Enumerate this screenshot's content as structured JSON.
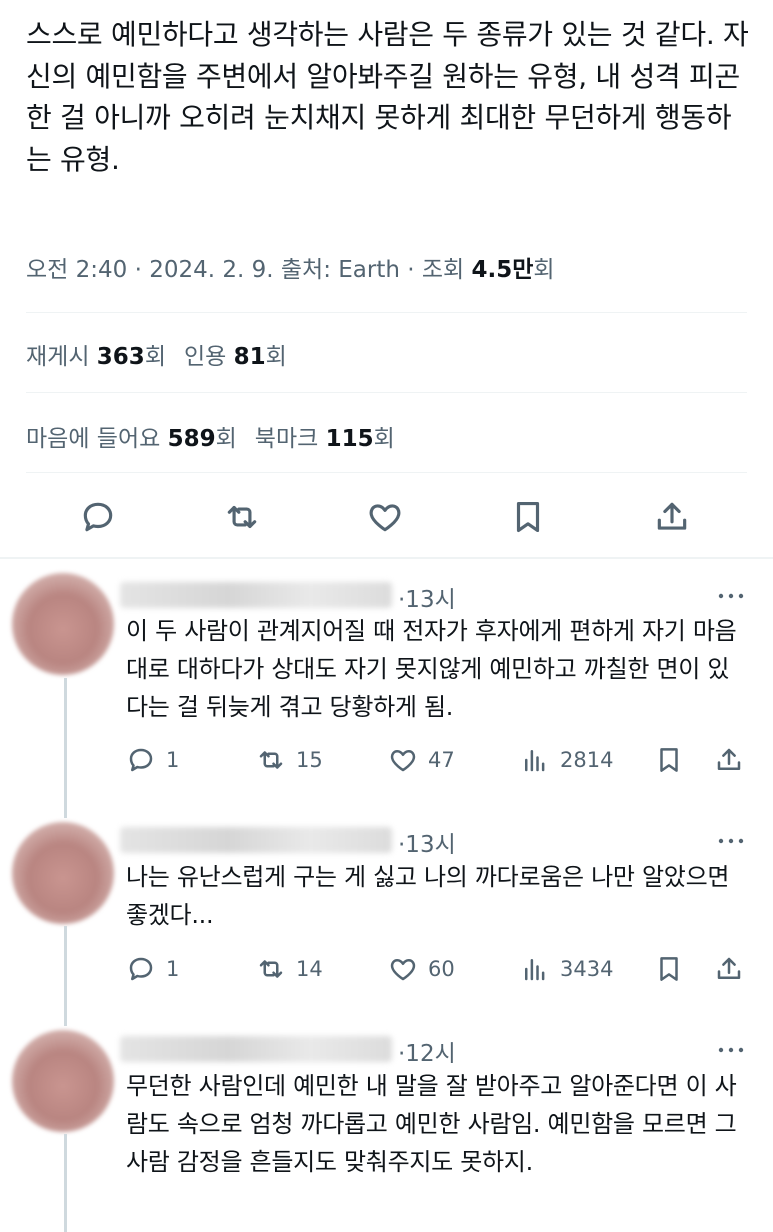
{
  "tweet": {
    "text": "스스로 예민하다고 생각하는 사람은 두 종류가 있는 것 같다. 자신의 예민함을 주변에서 알아봐주길 원하는 유형, 내 성격 피곤한 걸 아니까 오히려 눈치채지 못하게 최대한 무던하게 행동하는 유형.",
    "meta_prefix": "오전 2:40 · 2024. 2. 9. 출처: Earth · 조회 ",
    "views": "4.5만",
    "views_suffix": "회",
    "stats": {
      "retweets_label": "재게시",
      "retweets": "363",
      "retweets_suffix": "회",
      "quotes_label": "인용",
      "quotes": "81",
      "quotes_suffix": "회",
      "likes_label": "마음에 들어요",
      "likes": "589",
      "likes_suffix": "회",
      "bookmarks_label": "북마크",
      "bookmarks": "115",
      "bookmarks_suffix": "회"
    }
  },
  "icons": {
    "reply": "reply-icon",
    "retweet": "retweet-icon",
    "like": "heart-icon",
    "bookmark": "bookmark-icon",
    "share": "share-icon",
    "views": "bar-chart-icon",
    "more": "more-icon"
  },
  "colors": {
    "text": "#0f1419",
    "secondary": "#536471",
    "divider": "#eff3f4",
    "thread_line": "#cfd9de"
  },
  "replies": [
    {
      "time": "·13시",
      "text": "이 두 사람이 관계지어질 때 전자가 후자에게 편하게 자기 마음대로 대하다가 상대도 자기 못지않게 예민하고 까칠한 면이 있다는 걸 뒤늦게 겪고 당황하게 됨.",
      "replies": "1",
      "retweets": "15",
      "likes": "47",
      "views": "2814"
    },
    {
      "time": "·13시",
      "text": "나는 유난스럽게 구는 게 싫고 나의 까다로움은 나만 알았으면 좋겠다...",
      "replies": "1",
      "retweets": "14",
      "likes": "60",
      "views": "3434"
    },
    {
      "time": "·12시",
      "text": "무던한 사람인데 예민한 내 말을 잘 받아주고 알아준다면 이 사람도 속으로 엄청 까다롭고 예민한 사람임. 예민함을 모르면 그 사람 감정을 흔들지도 맞춰주지도 못하지."
    }
  ]
}
